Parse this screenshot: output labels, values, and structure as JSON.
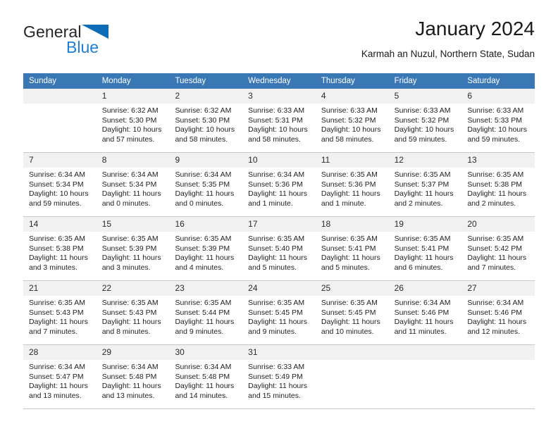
{
  "brand": {
    "word1": "General",
    "word2": "Blue",
    "triangle_color": "#0f6cb6",
    "word2_color": "#1b7fd4"
  },
  "header": {
    "title": "January 2024",
    "subtitle": "Karmah an Nuzul, Northern State, Sudan"
  },
  "theme": {
    "header_row_background": "#3a77b5",
    "header_row_text": "#ffffff",
    "day_number_background": "#f1f1f1",
    "grid_line": "#c8c8c8",
    "body_text": "#1f1f1f"
  },
  "weekdays": [
    "Sunday",
    "Monday",
    "Tuesday",
    "Wednesday",
    "Thursday",
    "Friday",
    "Saturday"
  ],
  "weeks": [
    [
      {
        "day": "",
        "empty": true,
        "sunrise": "",
        "sunset": "",
        "daylight_line1": "",
        "daylight_line2": ""
      },
      {
        "day": "1",
        "sunrise": "Sunrise: 6:32 AM",
        "sunset": "Sunset: 5:30 PM",
        "daylight_line1": "Daylight: 10 hours",
        "daylight_line2": "and 57 minutes."
      },
      {
        "day": "2",
        "sunrise": "Sunrise: 6:32 AM",
        "sunset": "Sunset: 5:30 PM",
        "daylight_line1": "Daylight: 10 hours",
        "daylight_line2": "and 58 minutes."
      },
      {
        "day": "3",
        "sunrise": "Sunrise: 6:33 AM",
        "sunset": "Sunset: 5:31 PM",
        "daylight_line1": "Daylight: 10 hours",
        "daylight_line2": "and 58 minutes."
      },
      {
        "day": "4",
        "sunrise": "Sunrise: 6:33 AM",
        "sunset": "Sunset: 5:32 PM",
        "daylight_line1": "Daylight: 10 hours",
        "daylight_line2": "and 58 minutes."
      },
      {
        "day": "5",
        "sunrise": "Sunrise: 6:33 AM",
        "sunset": "Sunset: 5:32 PM",
        "daylight_line1": "Daylight: 10 hours",
        "daylight_line2": "and 59 minutes."
      },
      {
        "day": "6",
        "sunrise": "Sunrise: 6:33 AM",
        "sunset": "Sunset: 5:33 PM",
        "daylight_line1": "Daylight: 10 hours",
        "daylight_line2": "and 59 minutes."
      }
    ],
    [
      {
        "day": "7",
        "sunrise": "Sunrise: 6:34 AM",
        "sunset": "Sunset: 5:34 PM",
        "daylight_line1": "Daylight: 10 hours",
        "daylight_line2": "and 59 minutes."
      },
      {
        "day": "8",
        "sunrise": "Sunrise: 6:34 AM",
        "sunset": "Sunset: 5:34 PM",
        "daylight_line1": "Daylight: 11 hours",
        "daylight_line2": "and 0 minutes."
      },
      {
        "day": "9",
        "sunrise": "Sunrise: 6:34 AM",
        "sunset": "Sunset: 5:35 PM",
        "daylight_line1": "Daylight: 11 hours",
        "daylight_line2": "and 0 minutes."
      },
      {
        "day": "10",
        "sunrise": "Sunrise: 6:34 AM",
        "sunset": "Sunset: 5:36 PM",
        "daylight_line1": "Daylight: 11 hours",
        "daylight_line2": "and 1 minute."
      },
      {
        "day": "11",
        "sunrise": "Sunrise: 6:35 AM",
        "sunset": "Sunset: 5:36 PM",
        "daylight_line1": "Daylight: 11 hours",
        "daylight_line2": "and 1 minute."
      },
      {
        "day": "12",
        "sunrise": "Sunrise: 6:35 AM",
        "sunset": "Sunset: 5:37 PM",
        "daylight_line1": "Daylight: 11 hours",
        "daylight_line2": "and 2 minutes."
      },
      {
        "day": "13",
        "sunrise": "Sunrise: 6:35 AM",
        "sunset": "Sunset: 5:38 PM",
        "daylight_line1": "Daylight: 11 hours",
        "daylight_line2": "and 2 minutes."
      }
    ],
    [
      {
        "day": "14",
        "sunrise": "Sunrise: 6:35 AM",
        "sunset": "Sunset: 5:38 PM",
        "daylight_line1": "Daylight: 11 hours",
        "daylight_line2": "and 3 minutes."
      },
      {
        "day": "15",
        "sunrise": "Sunrise: 6:35 AM",
        "sunset": "Sunset: 5:39 PM",
        "daylight_line1": "Daylight: 11 hours",
        "daylight_line2": "and 3 minutes."
      },
      {
        "day": "16",
        "sunrise": "Sunrise: 6:35 AM",
        "sunset": "Sunset: 5:39 PM",
        "daylight_line1": "Daylight: 11 hours",
        "daylight_line2": "and 4 minutes."
      },
      {
        "day": "17",
        "sunrise": "Sunrise: 6:35 AM",
        "sunset": "Sunset: 5:40 PM",
        "daylight_line1": "Daylight: 11 hours",
        "daylight_line2": "and 5 minutes."
      },
      {
        "day": "18",
        "sunrise": "Sunrise: 6:35 AM",
        "sunset": "Sunset: 5:41 PM",
        "daylight_line1": "Daylight: 11 hours",
        "daylight_line2": "and 5 minutes."
      },
      {
        "day": "19",
        "sunrise": "Sunrise: 6:35 AM",
        "sunset": "Sunset: 5:41 PM",
        "daylight_line1": "Daylight: 11 hours",
        "daylight_line2": "and 6 minutes."
      },
      {
        "day": "20",
        "sunrise": "Sunrise: 6:35 AM",
        "sunset": "Sunset: 5:42 PM",
        "daylight_line1": "Daylight: 11 hours",
        "daylight_line2": "and 7 minutes."
      }
    ],
    [
      {
        "day": "21",
        "sunrise": "Sunrise: 6:35 AM",
        "sunset": "Sunset: 5:43 PM",
        "daylight_line1": "Daylight: 11 hours",
        "daylight_line2": "and 7 minutes."
      },
      {
        "day": "22",
        "sunrise": "Sunrise: 6:35 AM",
        "sunset": "Sunset: 5:43 PM",
        "daylight_line1": "Daylight: 11 hours",
        "daylight_line2": "and 8 minutes."
      },
      {
        "day": "23",
        "sunrise": "Sunrise: 6:35 AM",
        "sunset": "Sunset: 5:44 PM",
        "daylight_line1": "Daylight: 11 hours",
        "daylight_line2": "and 9 minutes."
      },
      {
        "day": "24",
        "sunrise": "Sunrise: 6:35 AM",
        "sunset": "Sunset: 5:45 PM",
        "daylight_line1": "Daylight: 11 hours",
        "daylight_line2": "and 9 minutes."
      },
      {
        "day": "25",
        "sunrise": "Sunrise: 6:35 AM",
        "sunset": "Sunset: 5:45 PM",
        "daylight_line1": "Daylight: 11 hours",
        "daylight_line2": "and 10 minutes."
      },
      {
        "day": "26",
        "sunrise": "Sunrise: 6:34 AM",
        "sunset": "Sunset: 5:46 PM",
        "daylight_line1": "Daylight: 11 hours",
        "daylight_line2": "and 11 minutes."
      },
      {
        "day": "27",
        "sunrise": "Sunrise: 6:34 AM",
        "sunset": "Sunset: 5:46 PM",
        "daylight_line1": "Daylight: 11 hours",
        "daylight_line2": "and 12 minutes."
      }
    ],
    [
      {
        "day": "28",
        "sunrise": "Sunrise: 6:34 AM",
        "sunset": "Sunset: 5:47 PM",
        "daylight_line1": "Daylight: 11 hours",
        "daylight_line2": "and 13 minutes."
      },
      {
        "day": "29",
        "sunrise": "Sunrise: 6:34 AM",
        "sunset": "Sunset: 5:48 PM",
        "daylight_line1": "Daylight: 11 hours",
        "daylight_line2": "and 13 minutes."
      },
      {
        "day": "30",
        "sunrise": "Sunrise: 6:34 AM",
        "sunset": "Sunset: 5:48 PM",
        "daylight_line1": "Daylight: 11 hours",
        "daylight_line2": "and 14 minutes."
      },
      {
        "day": "31",
        "sunrise": "Sunrise: 6:33 AM",
        "sunset": "Sunset: 5:49 PM",
        "daylight_line1": "Daylight: 11 hours",
        "daylight_line2": "and 15 minutes."
      },
      {
        "day": "",
        "empty": true,
        "sunrise": "",
        "sunset": "",
        "daylight_line1": "",
        "daylight_line2": ""
      },
      {
        "day": "",
        "empty": true,
        "sunrise": "",
        "sunset": "",
        "daylight_line1": "",
        "daylight_line2": ""
      },
      {
        "day": "",
        "empty": true,
        "sunrise": "",
        "sunset": "",
        "daylight_line1": "",
        "daylight_line2": ""
      }
    ]
  ]
}
